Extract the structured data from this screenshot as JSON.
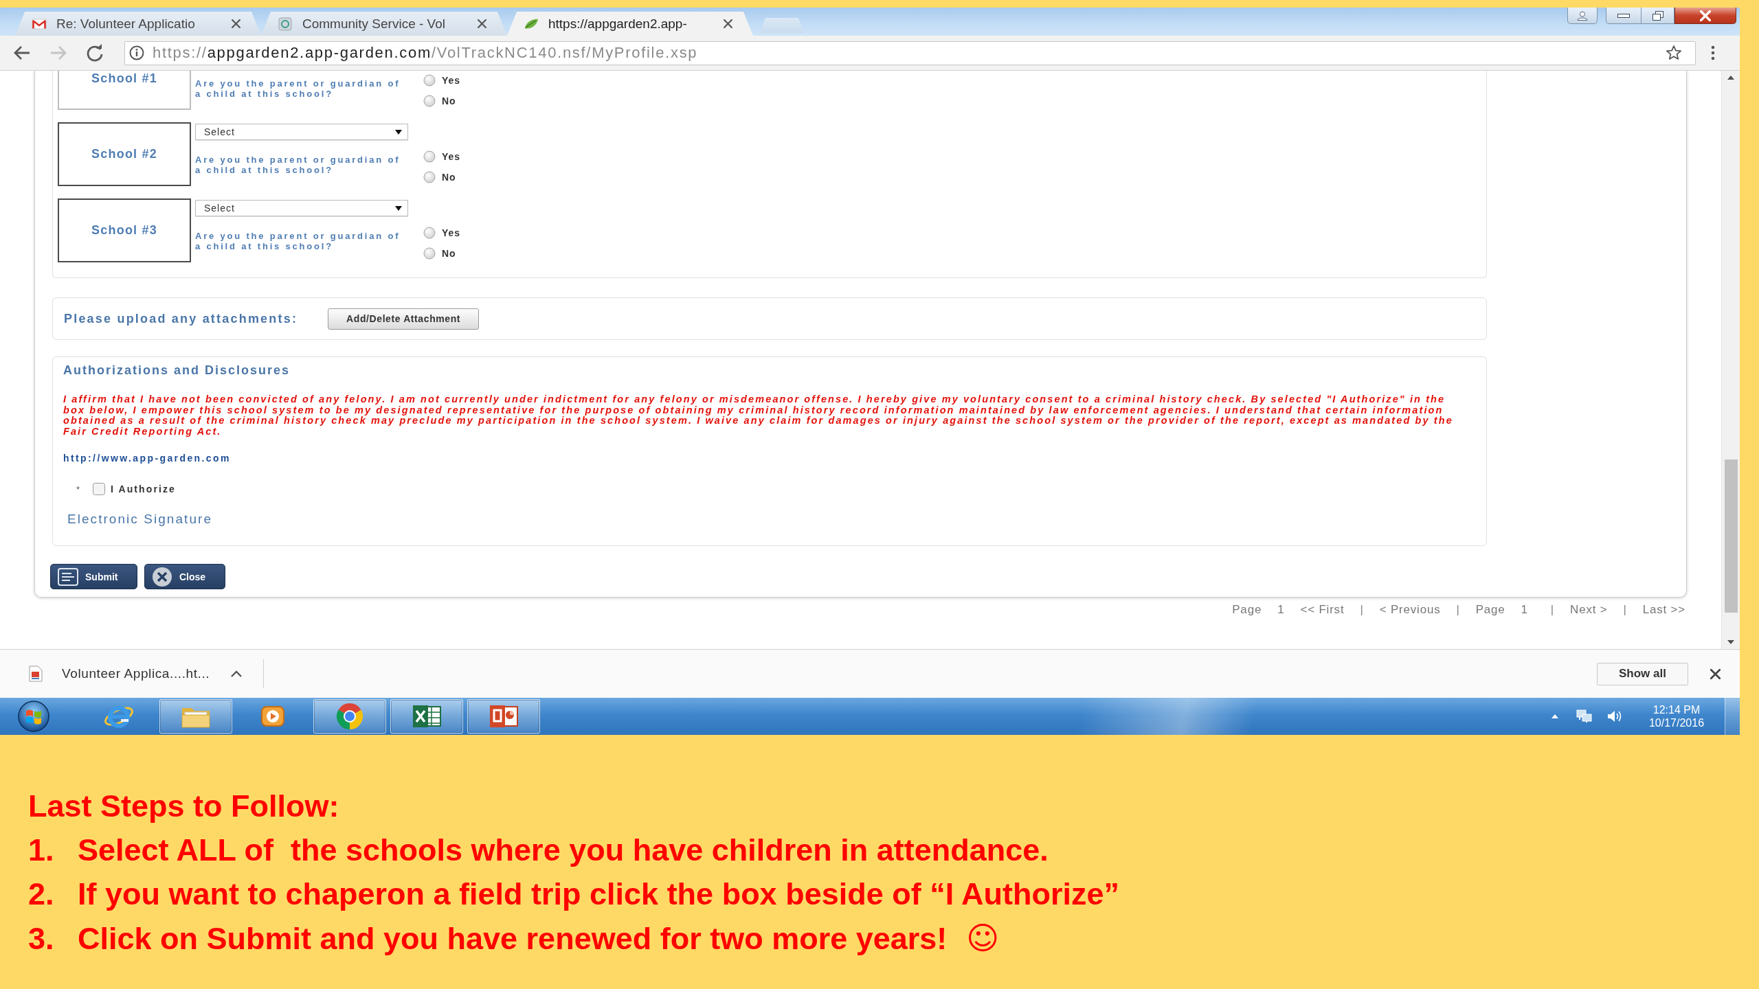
{
  "browser": {
    "tabs": [
      {
        "title": "Re: Volunteer Applicatio",
        "selected": false
      },
      {
        "title": "Community Service - Vol",
        "selected": false
      },
      {
        "title": "https://appgarden2.app-",
        "selected": true
      }
    ],
    "address": {
      "scheme": "https://",
      "host": "appgarden2.app-garden.com",
      "path": "/VolTrackNC140.nsf/MyProfile.xsp"
    }
  },
  "form": {
    "schools": [
      {
        "label": "School #1",
        "question": "Are you the parent or guardian of a child at this school?",
        "options": [
          {
            "label": "Yes",
            "selected": false
          },
          {
            "label": "No",
            "selected": false
          }
        ]
      },
      {
        "label": "School #2",
        "select": "Select",
        "question": "Are you the parent or guardian of a child at this school?",
        "options": [
          {
            "label": "Yes",
            "selected": false
          },
          {
            "label": "No",
            "selected": false
          }
        ]
      },
      {
        "label": "School #3",
        "select": "Select",
        "question": "Are you the parent or guardian of a child at this school?",
        "options": [
          {
            "label": "Yes",
            "selected": false
          },
          {
            "label": "No",
            "selected": false
          }
        ]
      }
    ],
    "attachments": {
      "label": "Please upload any attachments:",
      "button": "Add/Delete Attachment"
    },
    "authorizations": {
      "title": "Authorizations and Disclosures",
      "statement": "I affirm that I have not been convicted of any felony. I am not currently under indictment for any felony or misdemeanor offense. I hereby give my voluntary consent to a criminal history check. By selected \"I Authorize\" in the box below, I empower this school system to be my designated representative for the purpose of obtaining my criminal history record information maintained by law enforcement agencies. I understand that certain information obtained as a result of the criminal history check may preclude my participation in the school system. I waive any claim for damages or injury against the school system or the provider of the report, except as mandated by the Fair Credit Reporting Act.",
      "link": "http://www.app-garden.com",
      "required_mark": "*",
      "checkbox": {
        "label": "I Authorize",
        "checked": false
      },
      "signature_label": "Electronic Signature"
    },
    "buttons": [
      {
        "kind": "submit",
        "label": "Submit"
      },
      {
        "kind": "close",
        "label": "Close"
      }
    ]
  },
  "pagination": [
    {
      "kind": "label",
      "text": "Page"
    },
    {
      "kind": "label",
      "text": "1"
    },
    {
      "kind": "link",
      "text": "<< First"
    },
    {
      "kind": "separator",
      "text": "|"
    },
    {
      "kind": "link",
      "text": "< Previous"
    },
    {
      "kind": "separator",
      "text": "|"
    },
    {
      "kind": "label",
      "text": "Page"
    },
    {
      "kind": "label",
      "text": "1"
    },
    {
      "kind": "separator",
      "text": "|"
    },
    {
      "kind": "link",
      "text": "Next >"
    },
    {
      "kind": "separator",
      "text": "|"
    },
    {
      "kind": "link",
      "text": "Last >>"
    }
  ],
  "downloads": {
    "file": "Volunteer Applica....ht...",
    "show_all": "Show all"
  },
  "taskbar": {
    "apps": [
      {
        "kind": "browser",
        "running": false
      },
      {
        "kind": "folder",
        "running": true
      },
      {
        "kind": "media",
        "running": false
      },
      {
        "kind": "ring",
        "running": true
      },
      {
        "kind": "sheet",
        "running": true
      },
      {
        "kind": "slides",
        "running": true
      }
    ],
    "clock": {
      "time": "12:14 PM",
      "date": "10/17/2016"
    }
  },
  "instructions": {
    "title": "Last Steps to Follow:",
    "steps": [
      {
        "number": "1.",
        "text": "Select ALL of  the schools where you have children in attendance."
      },
      {
        "number": "2.",
        "text": "If you want to chaperon a field trip click the box beside of “I Authorize”"
      },
      {
        "number": "3.",
        "text": "Click on Submit and you have renewed for two more years!",
        "emoji": "☺"
      }
    ]
  }
}
